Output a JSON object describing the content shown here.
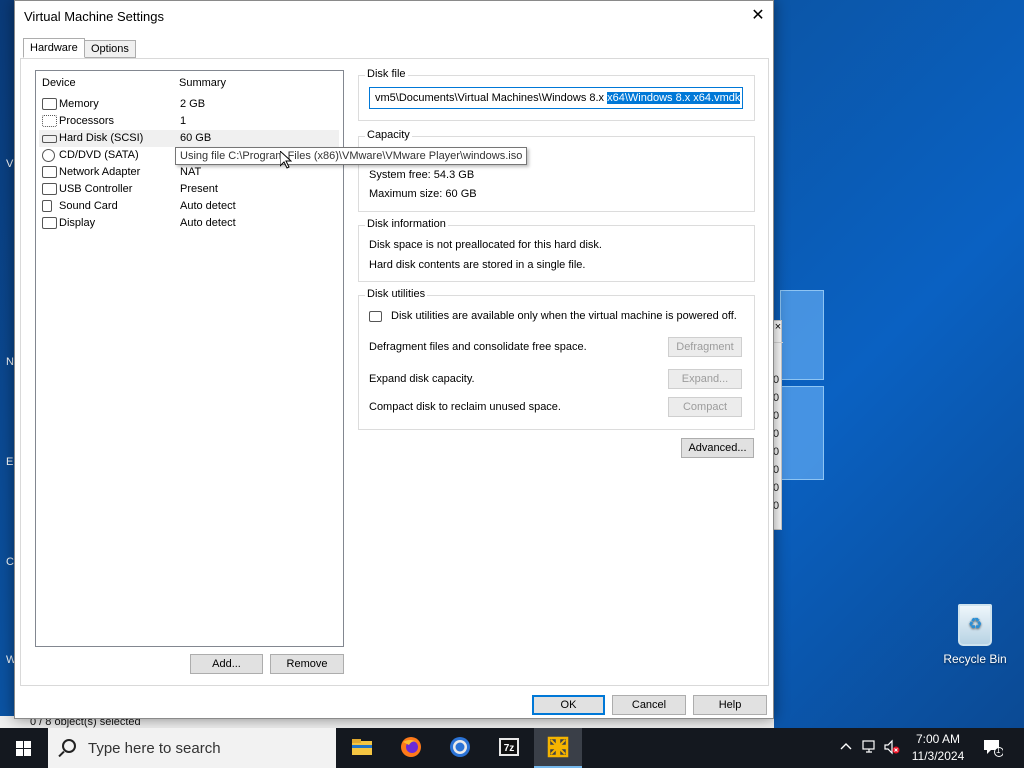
{
  "dialog": {
    "title": "Virtual Machine Settings",
    "close_glyph": "✕",
    "tabs": [
      {
        "label": "Hardware"
      },
      {
        "label": "Options"
      }
    ]
  },
  "device_list": {
    "headers": {
      "device": "Device",
      "summary": "Summary"
    },
    "items": [
      {
        "name": "Memory",
        "summary": "2 GB",
        "icon": "memory-icon"
      },
      {
        "name": "Processors",
        "summary": "1",
        "icon": "processor-icon"
      },
      {
        "name": "Hard Disk (SCSI)",
        "summary": "60 GB",
        "icon": "hard-disk-icon"
      },
      {
        "name": "CD/DVD (SATA)",
        "summary": "",
        "icon": "cd-dvd-icon"
      },
      {
        "name": "Network Adapter",
        "summary": "NAT",
        "icon": "network-adapter-icon"
      },
      {
        "name": "USB Controller",
        "summary": "Present",
        "icon": "usb-icon"
      },
      {
        "name": "Sound Card",
        "summary": "Auto detect",
        "icon": "speaker-icon"
      },
      {
        "name": "Display",
        "summary": "Auto detect",
        "icon": "monitor-icon"
      }
    ],
    "tooltip": "Using file C:\\Program Files (x86)\\VMware\\VMware Player\\windows.iso",
    "add_label": "Add...",
    "remove_label": "Remove"
  },
  "disk_file": {
    "label": "Disk file",
    "value_unselected": "vm5\\Documents\\Virtual Machines\\Windows 8.x ",
    "value_selected": "x64\\Windows 8.x x64.vmdk"
  },
  "capacity": {
    "label": "Capacity",
    "system_free": "System free:  54.3 GB",
    "maximum_size": "Maximum size:  60 GB"
  },
  "disk_information": {
    "label": "Disk information",
    "line1": "Disk space is not preallocated for this hard disk.",
    "line2": "Hard disk contents are stored in a single file."
  },
  "disk_utilities": {
    "label": "Disk utilities",
    "note": "Disk utilities are available only when the virtual machine is powered off.",
    "rows": [
      {
        "text": "Defragment files and consolidate free space.",
        "button": "Defragment"
      },
      {
        "text": "Expand disk capacity.",
        "button": "Expand..."
      },
      {
        "text": "Compact disk to reclaim unused space.",
        "button": "Compact"
      }
    ]
  },
  "advanced_label": "Advanced...",
  "footer": {
    "ok": "OK",
    "cancel": "Cancel",
    "help": "Help"
  },
  "desktop": {
    "recycle_bin": "Recycle Bin",
    "status_text": "0 / 8 object(s) selected",
    "left_edge_letters": [
      "V",
      "N",
      "E",
      "C",
      "W"
    ],
    "bg_window_digits": [
      "0",
      "0",
      "0",
      "0",
      "0",
      "0",
      "0",
      "0"
    ]
  },
  "taskbar": {
    "search_placeholder": "Type here to search",
    "apps": [
      "file-explorer-icon",
      "firefox-icon",
      "chrome-icon",
      "7zip-icon",
      "vmware-icon"
    ],
    "sevenzip_label": "7z",
    "time": "7:00 AM",
    "date": "11/3/2024",
    "notification_count": "1"
  },
  "colors": {
    "accent": "#0078d7",
    "desktop": "#0b56a8",
    "taskbar": "#14181f"
  }
}
